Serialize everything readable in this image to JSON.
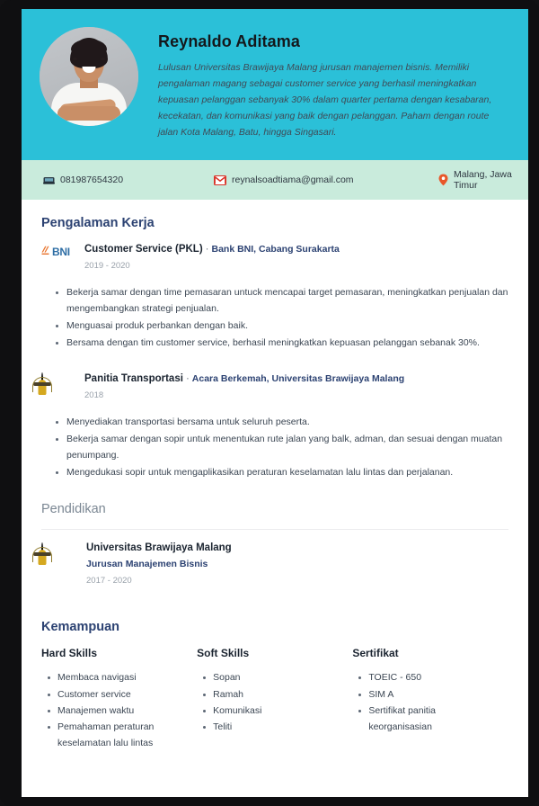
{
  "theme": {
    "header_bg": "#2bc0d8",
    "contact_bg": "#c9ebdc",
    "accent_navy": "#2c4272",
    "muted_gray": "#7b8793",
    "pin_color": "#e8572a",
    "gmail_red": "#d93025"
  },
  "header": {
    "name": "Reynaldo Aditama",
    "summary": "Lulusan Universitas Brawijaya Malang jurusan manajemen bisnis. Memiliki pengalaman magang sebagai customer service yang berhasil meningkatkan kepuasan pelanggan sebanyak 30% dalam quarter pertama dengan kesabaran, kecekatan, dan komunikasi yang baik dengan pelanggan. Paham dengan route jalan Kota Malang, Batu, hingga Singasari.",
    "avatar_alt": "profile-photo"
  },
  "contact": {
    "phone": "081987654320",
    "email": "reynalsoadtiama@gmail.com",
    "location": "Malang, Jawa Timur",
    "phone_icon": "phone-icon",
    "email_icon": "gmail-icon",
    "location_icon": "map-pin-icon"
  },
  "experience": {
    "title": "Pengalaman Kerja",
    "entries": [
      {
        "logo": "bni-logo",
        "logo_text": "BNI",
        "role": "Customer Service (PKL)",
        "separator": "·",
        "org": "Bank BNI, Cabang Surakarta",
        "years": "2019 - 2020",
        "bullets": [
          "Bekerja samar dengan time pemasaran untuck mencapai target pemasaran, meningkatkan penjualan dan mengembangkan strategi penjualan.",
          "Menguasai produk perbankan dengan baik.",
          "Bersama dengan tim customer service, berhasil meningkatkan kepuasan pelanggan sebanak 30%."
        ]
      },
      {
        "logo": "universitas-brawijaya-crest",
        "logo_text": "",
        "role": "Panitia Transportasi",
        "separator": "·",
        "org": "Acara Berkemah, Universitas Brawijaya Malang",
        "years": "2018",
        "bullets": [
          "Menyediakan transportasi bersama untuk seluruh peserta.",
          "Bekerja samar dengan sopir untuk menentukan rute jalan yang balk, adman, dan sesuai dengan muatan penumpang.",
          "Mengedukasi sopir untuk mengaplikasikan peraturan keselamatan lalu lintas dan perjalanan."
        ]
      }
    ]
  },
  "education": {
    "title": "Pendidikan",
    "entries": [
      {
        "logo": "universitas-brawijaya-crest",
        "school": "Universitas Brawijaya Malang",
        "major": "Jurusan Manajemen Bisnis",
        "years": "2017 - 2020"
      }
    ]
  },
  "skills": {
    "title": "Kemampuan",
    "columns": [
      {
        "heading": "Hard Skills",
        "items": [
          "Membaca navigasi",
          "Customer service",
          "Manajemen waktu",
          "Pemahaman peraturan keselamatan lalu lintas"
        ]
      },
      {
        "heading": "Soft Skills",
        "items": [
          "Sopan",
          "Ramah",
          "Komunikasi",
          "Teliti"
        ]
      },
      {
        "heading": "Sertifikat",
        "items": [
          "TOEIC - 650",
          "SIM A",
          "Sertifikat panitia keorganisasian"
        ]
      }
    ]
  }
}
